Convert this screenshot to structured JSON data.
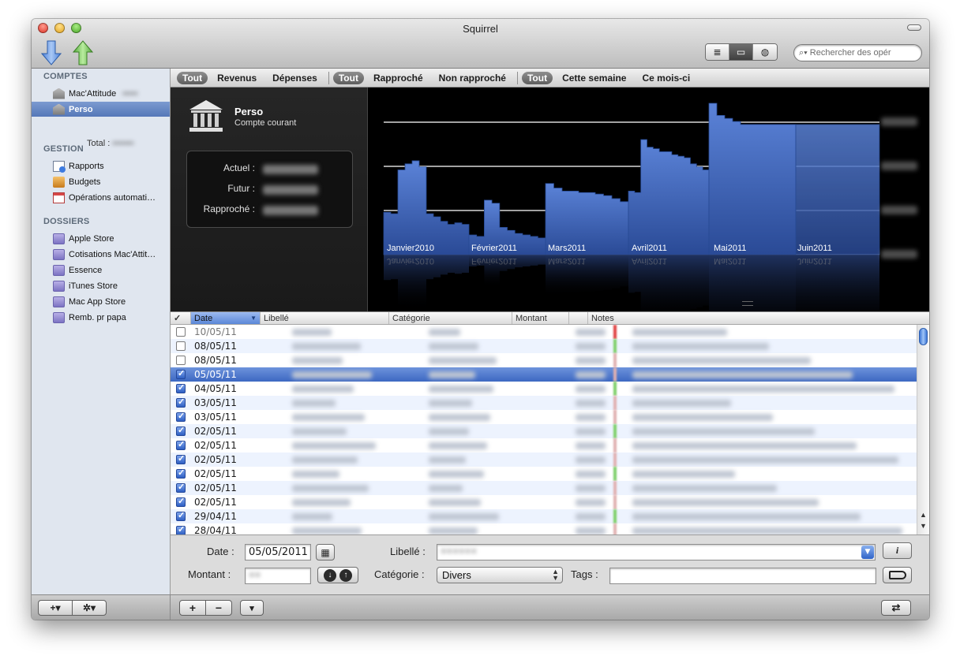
{
  "window": {
    "title": "Squirrel"
  },
  "toolbar": {
    "import_icon": "down-arrow-icon",
    "export_icon": "up-arrow-icon",
    "view_modes": [
      {
        "icon": "list-view-icon",
        "glyph": "≣",
        "selected": false
      },
      {
        "icon": "card-view-icon",
        "glyph": "▭",
        "selected": true
      },
      {
        "icon": "globe-view-icon",
        "glyph": "◍",
        "selected": false
      }
    ],
    "search_placeholder": "Rechercher des opér"
  },
  "sidebar": {
    "comptes_header": "COMPTES",
    "accounts": [
      {
        "label": "Mac'Attitude",
        "selected": false
      },
      {
        "label": "Perso",
        "selected": true
      }
    ],
    "total_label": "Total :",
    "gestion_header": "GESTION",
    "gestion_items": [
      {
        "label": "Rapports",
        "icon": "report-icon"
      },
      {
        "label": "Budgets",
        "icon": "budget-icon"
      },
      {
        "label": "Opérations automati…",
        "icon": "calendar-icon"
      }
    ],
    "dossiers_header": "DOSSIERS",
    "folders": [
      "Apple Store",
      "Cotisations Mac'Attit…",
      "Essence",
      "iTunes Store",
      "Mac App Store",
      "Remb. pr papa"
    ],
    "add_label": "+▾",
    "gear_label": "✲▾"
  },
  "filters": {
    "group1": [
      "Tout",
      "Revenus",
      "Dépenses"
    ],
    "group2": [
      "Tout",
      "Rapproché",
      "Non rapproché"
    ],
    "group3": [
      "Tout",
      "Cette semaine",
      "Ce mois-ci"
    ]
  },
  "account_panel": {
    "name": "Perso",
    "type": "Compte courant",
    "actuel_label": "Actuel :",
    "futur_label": "Futur :",
    "rapproche_label": "Rapproché :"
  },
  "chart_data": {
    "type": "area",
    "x_labels": [
      "Janvier2010",
      "Février2011",
      "Mars2011",
      "Avril2011",
      "Mai2011",
      "Juin2011"
    ],
    "grid": true
  },
  "table": {
    "columns": [
      "✓",
      "Date",
      "Libellé",
      "Catégorie",
      "Montant",
      "Notes"
    ],
    "rows": [
      {
        "checked": false,
        "date": "10/05/11",
        "faded": true
      },
      {
        "checked": false,
        "date": "08/05/11"
      },
      {
        "checked": false,
        "date": "08/05/11"
      },
      {
        "checked": true,
        "date": "05/05/11",
        "selected": true
      },
      {
        "checked": true,
        "date": "04/05/11"
      },
      {
        "checked": true,
        "date": "03/05/11"
      },
      {
        "checked": true,
        "date": "03/05/11"
      },
      {
        "checked": true,
        "date": "02/05/11"
      },
      {
        "checked": true,
        "date": "02/05/11"
      },
      {
        "checked": true,
        "date": "02/05/11"
      },
      {
        "checked": true,
        "date": "02/05/11"
      },
      {
        "checked": true,
        "date": "02/05/11"
      },
      {
        "checked": true,
        "date": "02/05/11"
      },
      {
        "checked": true,
        "date": "29/04/11"
      },
      {
        "checked": true,
        "date": "28/04/11"
      }
    ]
  },
  "editor": {
    "date_label": "Date :",
    "date_value": "05/05/2011",
    "libelle_label": "Libellé :",
    "montant_label": "Montant :",
    "categorie_label": "Catégorie :",
    "categorie_value": "Divers",
    "tags_label": "Tags :",
    "info_label": "i"
  },
  "bottom": {
    "add": "+",
    "remove": "−"
  }
}
